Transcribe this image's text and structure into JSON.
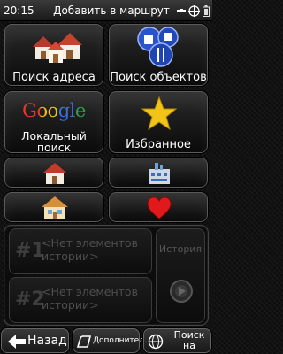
{
  "status_bar": {
    "time": "20:15",
    "title": "Добавить в маршрут"
  },
  "tiles": {
    "address_search": "Поиск адреса",
    "poi_search": "Поиск объектов",
    "local_search_logo": "Google",
    "local_search": "Локальный поиск",
    "favorites": "Избранное"
  },
  "history": {
    "title": "История",
    "items": [
      {
        "number": "#1",
        "text": "<Нет элементов истории>"
      },
      {
        "number": "#2",
        "text": "<Нет элементов истории>"
      }
    ]
  },
  "bottom_bar": {
    "back": "Назад",
    "more": "Дополнител...",
    "map_search": "Поиск на карте"
  },
  "colors": {
    "background": "#111111",
    "status_bar": "#2a2a2a",
    "disabled_text": "#4e4e4e",
    "favorite_star": "#f2c418",
    "heart": "#e01a1a"
  }
}
